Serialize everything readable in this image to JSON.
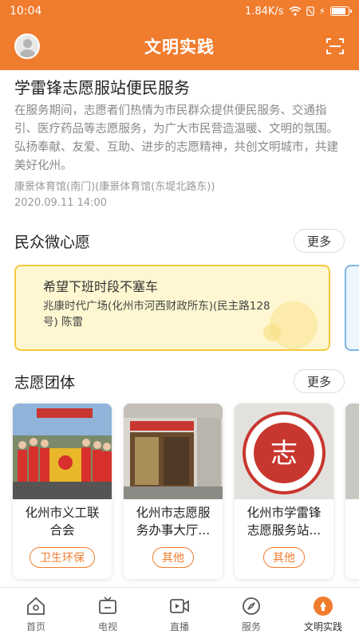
{
  "status_bar": {
    "time": "10:04",
    "network_speed": "1.84K/s",
    "battery_level": 0.9
  },
  "header": {
    "title": "文明实践",
    "avatar_icon": "user-avatar-icon",
    "scan_icon": "scan-icon"
  },
  "article": {
    "title": "学雷锋志愿服站便民服务",
    "description": "在服务期间，志愿者们热情为市民群众提供便民服务、交通指引、医疗药品等志愿服务，为广大市民营造温暖、文明的氛围。弘扬奉献、友爱、互助、进步的志愿精神，共创文明城市，共建美好化州。",
    "location": "康景体育馆(南门)(康景体育馆(东堤北路东))",
    "time": "2020.09.11 14:00"
  },
  "wishes": {
    "title": "民众微心愿",
    "more_label": "更多",
    "items": [
      {
        "title": "希望下班时段不塞车",
        "subtitle": "兆康时代广场(化州市河西财政所东)(民主路128号) 陈雷"
      }
    ]
  },
  "teams": {
    "title": "志愿团体",
    "more_label": "更多",
    "items": [
      {
        "name": "化州市义工联合会",
        "tag": "卫生环保"
      },
      {
        "name": "化州市志愿服务办事大厅...",
        "tag": "其他"
      },
      {
        "name": "化州市学雷锋志愿服务站...",
        "tag": "其他"
      }
    ],
    "badge_text": "志"
  },
  "bottom_nav": [
    {
      "label": "首页",
      "icon": "home-icon"
    },
    {
      "label": "电视",
      "icon": "tv-icon"
    },
    {
      "label": "直播",
      "icon": "live-icon"
    },
    {
      "label": "服务",
      "icon": "compass-icon"
    },
    {
      "label": "文明实践",
      "icon": "civilization-icon",
      "active": true
    }
  ],
  "colors": {
    "brand": "#f07c2e",
    "wish_bg": "#fff7d1",
    "wish_border": "#f5c93e"
  }
}
